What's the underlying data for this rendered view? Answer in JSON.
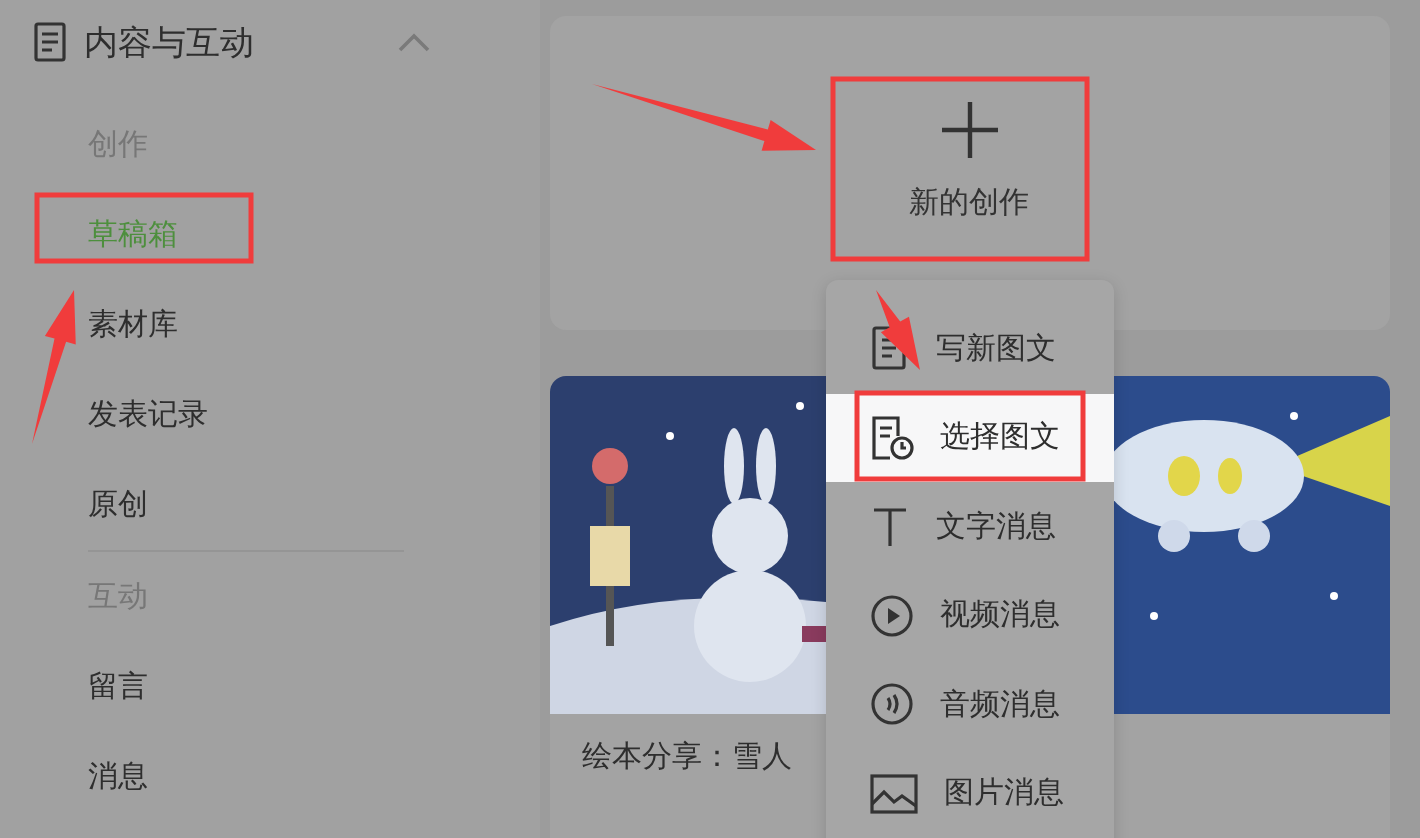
{
  "sidebar": {
    "section": {
      "title": "内容与互动",
      "expanded": true
    },
    "items": [
      {
        "kind": "heading",
        "label": "创作"
      },
      {
        "kind": "link",
        "label": "草稿箱",
        "selected": true
      },
      {
        "kind": "link",
        "label": "素材库",
        "selected": false
      },
      {
        "kind": "link",
        "label": "发表记录",
        "selected": false
      },
      {
        "kind": "link",
        "label": "原创",
        "selected": false
      },
      {
        "kind": "divider"
      },
      {
        "kind": "heading",
        "label": "互动"
      },
      {
        "kind": "link",
        "label": "留言",
        "selected": false
      },
      {
        "kind": "link",
        "label": "消息",
        "selected": false
      }
    ]
  },
  "new_creation": {
    "label": "新的创作"
  },
  "create_menu": {
    "items": [
      {
        "label": "写新图文",
        "highlighted": false
      },
      {
        "label": "选择图文",
        "highlighted": true
      },
      {
        "label": "文字消息",
        "highlighted": false
      },
      {
        "label": "视频消息",
        "highlighted": false
      },
      {
        "label": "音频消息",
        "highlighted": false
      },
      {
        "label": "图片消息",
        "highlighted": false
      }
    ]
  },
  "article": {
    "title": "绘本分享：雪人"
  }
}
